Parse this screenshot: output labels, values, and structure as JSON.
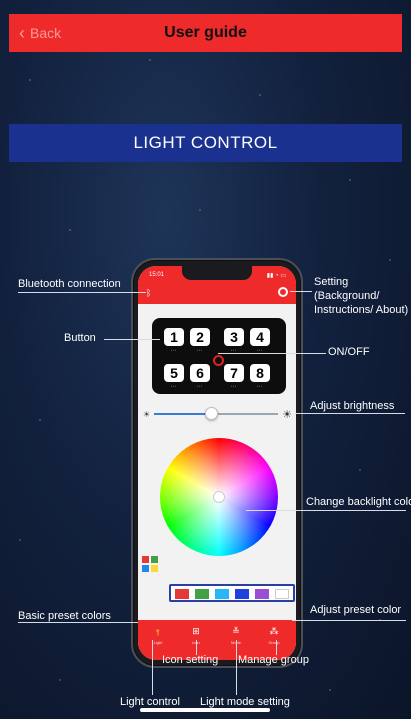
{
  "header": {
    "back_label": "Back",
    "title": "User guide",
    "back_icon": "chevron-left-icon"
  },
  "banner": {
    "title": "LIGHT CONTROL"
  },
  "annotations": {
    "bluetooth": "Bluetooth connection",
    "setting_line1": "Setting",
    "setting_line2": "(Background/",
    "setting_line3": "Instructions/ About)",
    "button": "Button",
    "on_off": "ON/OFF",
    "brightness": "Adjust brightness",
    "backlight": "Change backlight colo",
    "basic_preset": "Basic preset colors",
    "adjust_preset": "Adjust preset color",
    "icon_setting": "Icon setting",
    "manage_group": "Manage group",
    "light_control": "Light control",
    "light_mode": "Light mode setting"
  },
  "phone": {
    "status_time": "15:01",
    "keys": [
      "1",
      "2",
      "3",
      "4",
      "5",
      "6",
      "7",
      "8"
    ],
    "brightness_level": 0.45,
    "mini_colors": [
      "#e53935",
      "#43a047",
      "#1e88e5",
      "#fdd835"
    ],
    "preset_colors": [
      "#e53935",
      "#43a047",
      "#29b6f6",
      "#1e40e0",
      "#9c4dd6",
      "#ffffff"
    ],
    "tabs": [
      {
        "label": "Light",
        "icon": "light-control-icon"
      },
      {
        "label": "Icon",
        "icon": "grid-icon"
      },
      {
        "label": "Mode",
        "icon": "light-mode-icon"
      },
      {
        "label": "Group",
        "icon": "group-icon"
      }
    ]
  },
  "colors": {
    "accent_red": "#ee2a2a",
    "banner_blue": "#1a3190"
  }
}
